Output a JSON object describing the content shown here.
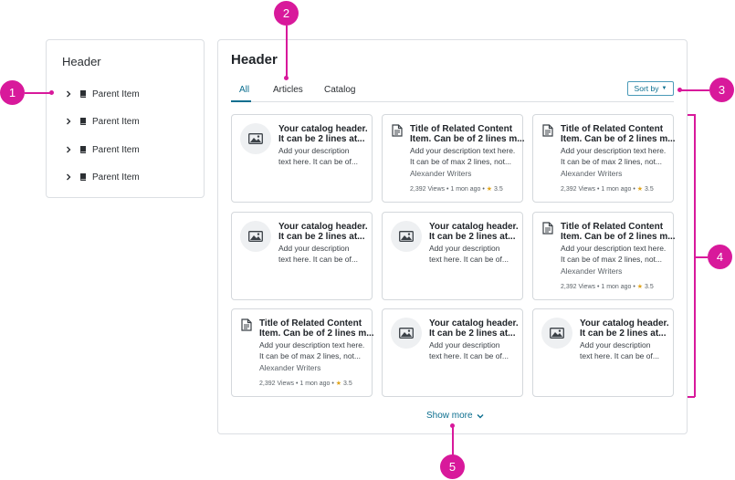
{
  "left_panel": {
    "header": "Header",
    "items": [
      {
        "label": "Parent Item"
      },
      {
        "label": "Parent Item"
      },
      {
        "label": "Parent Item"
      },
      {
        "label": "Parent Item"
      }
    ]
  },
  "main_panel": {
    "header": "Header",
    "tabs": [
      {
        "label": "All",
        "active": true
      },
      {
        "label": "Articles",
        "active": false
      },
      {
        "label": "Catalog",
        "active": false
      }
    ],
    "sort_label": "Sort by",
    "cards": [
      {
        "kind": "catalog",
        "title1": "Your catalog header.",
        "title2": "It can be 2 lines at...",
        "desc1": "Add your description",
        "desc2": "text here. It can be of..."
      },
      {
        "kind": "article",
        "title1": "Title of Related Content",
        "title2": "Item. Can be of 2 lines m...",
        "desc1": "Add your description text here.",
        "desc2": "It can be of max 2 lines, not...",
        "author": "Alexander Writers",
        "views": "2,392 Views",
        "time": "1 mon ago",
        "rating": "3.5"
      },
      {
        "kind": "article",
        "title1": "Title of Related Content",
        "title2": "Item. Can be of 2 lines m...",
        "desc1": "Add your description text here.",
        "desc2": "It can be of max 2 lines, not...",
        "author": "Alexander Writers",
        "views": "2,392 Views",
        "time": "1 mon ago",
        "rating": "3.5"
      },
      {
        "kind": "catalog",
        "title1": "Your catalog header.",
        "title2": "It can be 2 lines at...",
        "desc1": "Add your description",
        "desc2": "text here. It can be of..."
      },
      {
        "kind": "catalog",
        "title1": "Your catalog header.",
        "title2": "It can be 2 lines at...",
        "desc1": "Add your description",
        "desc2": "text here. It can be of..."
      },
      {
        "kind": "article",
        "title1": "Title of Related Content",
        "title2": "Item. Can be of 2 lines m...",
        "desc1": "Add your description text here.",
        "desc2": "It can be of max 2 lines, not...",
        "author": "Alexander Writers",
        "views": "2,392 Views",
        "time": "1 mon ago",
        "rating": "3.5"
      },
      {
        "kind": "article",
        "title1": "Title of Related Content",
        "title2": "Item. Can be of 2 lines m...",
        "desc1": "Add your description text here.",
        "desc2": "It can be of max 2 lines, not...",
        "author": "Alexander Writers",
        "views": "2,392 Views",
        "time": "1 mon ago",
        "rating": "3.5"
      },
      {
        "kind": "catalog",
        "title1": "Your catalog header.",
        "title2": "It can be 2 lines at...",
        "desc1": "Add your description",
        "desc2": "text here. It can be of..."
      },
      {
        "kind": "catalog",
        "title1": "Your catalog header.",
        "title2": "It can be 2 lines at...",
        "desc1": "Add your description",
        "desc2": "text here. It can be of..."
      }
    ],
    "show_more": "Show more"
  },
  "annotations": {
    "m1": "1",
    "m2": "2",
    "m3": "3",
    "m4": "4",
    "m5": "5"
  },
  "colors": {
    "accent": "#0b6e8f",
    "marker": "#d8199b",
    "star": "#e0a41b"
  }
}
